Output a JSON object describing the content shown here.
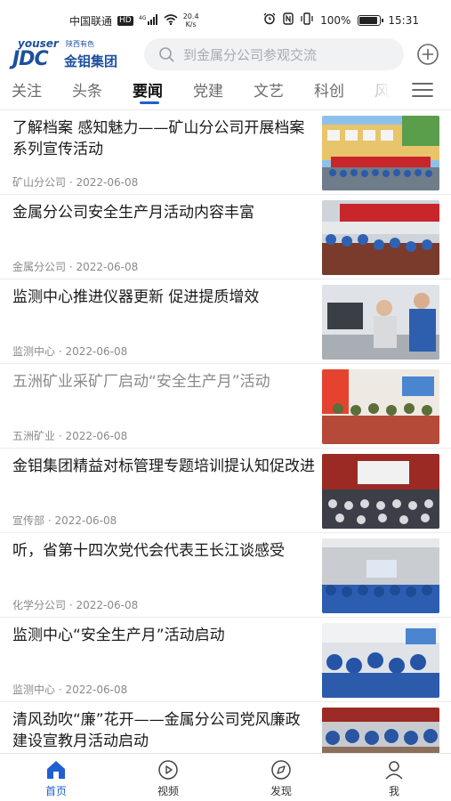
{
  "status_bar": {
    "carrier": "中国联通",
    "hd": "HD",
    "network": "4G",
    "speed_value": "20.4",
    "speed_unit": "K/s",
    "battery_percent": "100%",
    "battery_level": 1.0,
    "time": "15:31"
  },
  "header": {
    "logo_top": "youser",
    "logo_top_cn": "陕西有色",
    "logo_main": "JDC",
    "logo_name": "金钼集团",
    "search_placeholder": "到金属分公司参观交流"
  },
  "tabs": [
    {
      "label": "关注",
      "active": false
    },
    {
      "label": "头条",
      "active": false
    },
    {
      "label": "要闻",
      "active": true
    },
    {
      "label": "党建",
      "active": false
    },
    {
      "label": "文艺",
      "active": false
    },
    {
      "label": "科创",
      "active": false
    },
    {
      "label": "风采",
      "active": false
    }
  ],
  "news": [
    {
      "title": "了解档案  感知魅力——矿山分公司开展档案系列宣传活动",
      "source": "矿山分公司",
      "date": "2022-06-08",
      "read": false,
      "thumb": "outdoor-banner"
    },
    {
      "title": "金属分公司安全生产月活动内容丰富",
      "source": "金属分公司",
      "date": "2022-06-08",
      "read": false,
      "thumb": "meeting-room"
    },
    {
      "title": "监测中心推进仪器更新 促进提质增效",
      "source": "监测中心",
      "date": "2022-06-08",
      "read": false,
      "thumb": "lab"
    },
    {
      "title": "五洲矿业采矿厂启动“安全生产月”活动",
      "source": "五洲矿业",
      "date": "2022-06-08",
      "read": true,
      "thumb": "conference-screen"
    },
    {
      "title": "金钼集团精益对标管理专题培训提认知促改进",
      "source": "宣传部",
      "date": "2022-06-08",
      "read": false,
      "thumb": "training-hall"
    },
    {
      "title": "听，省第十四次党代会代表王长江谈感受",
      "source": "化学分公司",
      "date": "2022-06-08",
      "read": false,
      "thumb": "auditorium"
    },
    {
      "title": "监测中心“安全生产月”活动启动",
      "source": "监测中心",
      "date": "2022-06-08",
      "read": false,
      "thumb": "workers-meeting"
    },
    {
      "title": "清风劲吹“廉”花开——金属分公司党风廉政建设宣教月活动启动",
      "source": "",
      "date": "",
      "read": false,
      "thumb": "party-meeting"
    }
  ],
  "meta_separator": "·",
  "bottom_nav": [
    {
      "label": "首页",
      "icon": "home-icon",
      "active": true
    },
    {
      "label": "视频",
      "icon": "play-icon",
      "active": false
    },
    {
      "label": "发现",
      "icon": "compass-icon",
      "active": false
    },
    {
      "label": "我",
      "icon": "user-icon",
      "active": false
    }
  ],
  "colors": {
    "accent": "#1f5fd1",
    "brand": "#1d4f9e",
    "read_text": "#8a8a8a"
  }
}
